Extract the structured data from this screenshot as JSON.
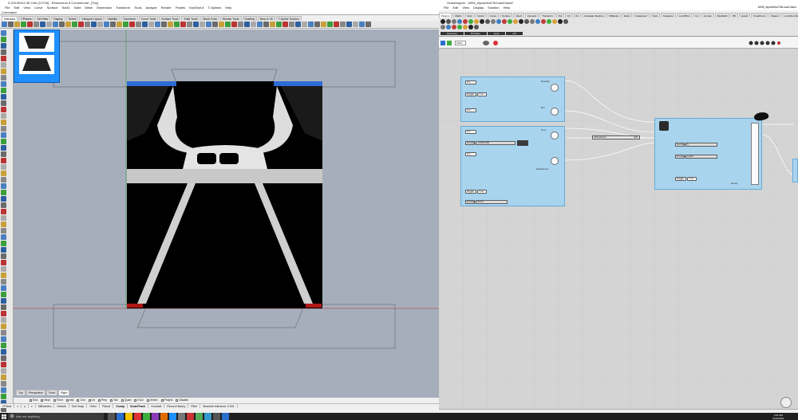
{
  "rhino": {
    "title": "S-20190312 3D Unit (12708) - Rhinoceros 6 Commercial - [Top]",
    "menu": [
      "File",
      "Edit",
      "View",
      "Curve",
      "Surface",
      "SubD",
      "Solid",
      "Mesh",
      "Dimension",
      "Transform",
      "Tools",
      "Analyze",
      "Render",
      "Panels",
      "KeyShot 8",
      "T-Splines",
      "Help"
    ],
    "command_label": "Command:",
    "command_value": "",
    "toolbar_tabs": [
      "Standard",
      "CPlanes",
      "Set View",
      "Display",
      "Select",
      "Viewport Layout",
      "Visibility",
      "Transform",
      "Curve Tools",
      "Surface Tools",
      "Solid Tools",
      "Mesh Tools",
      "Render Tools",
      "Drafting",
      "New in V6",
      "T-Spline Toolbox"
    ],
    "viewport_tabs": [
      "Top",
      "Perspective",
      "Front",
      "Right"
    ],
    "active_viewport_tab": "Right",
    "osnaps": [
      "End",
      "Near",
      "Point",
      "Mid",
      "Cen",
      "Int",
      "Perp",
      "Tan",
      "Quad",
      "Knot",
      "Vertex",
      "Project",
      "Disable"
    ],
    "status": [
      "CPlane",
      "x",
      "y",
      "z",
      "Millimeters",
      "Default",
      "Grid Snap",
      "Ortho",
      "Planar",
      "Osnap",
      "SmartTrack",
      "Gumball",
      "Record History",
      "Filter",
      "Absolute tolerance: 0.001"
    ]
  },
  "grasshopper": {
    "title": "Grasshopper - b006_bipolarNoCWLoadCases*",
    "doc_name": "b006_bipolarNoCWLoadCases",
    "menu": [
      "File",
      "Edit",
      "View",
      "Display",
      "Solution",
      "Help"
    ],
    "component_tabs": [
      "Params",
      "Maths",
      "Sets",
      "Vector",
      "Curve",
      "Surface",
      "Mesh",
      "Intersect",
      "Transform",
      "Dis",
      "Fit",
      "Kit",
      "Cartesian Meshes",
      "Millipede",
      "Extra",
      "Kangaroo2",
      "NuG",
      "Kangaroo",
      "LunchBox",
      "Ivy",
      "Human",
      "MeshEdit",
      "Bfl",
      "gHowl",
      "SmartForm",
      "Weave",
      "Lunchbox Meshes"
    ],
    "panel_groups": [
      "Geometry",
      "Primitive",
      "Input",
      "Util"
    ],
    "zoom": "100%",
    "nodes": {
      "crv1": "Crv",
      "crv2": "Crv",
      "crv3": "Crv",
      "crv4": "Crv",
      "toggle1_label": "Toggle",
      "toggle1_value": "True",
      "toggle2_label": "Toggle",
      "toggle2_value": "True",
      "toggle3_label": "Toggle",
      "toggle3_value": "True",
      "num1_label": "Number",
      "num1_value": "-10000.000",
      "num2_label": "Number",
      "num2_value": "0.570",
      "num3_label": "Number",
      "num3_value": "5",
      "num4_label": "Number",
      "num4_value": "0.400",
      "resolution_label": "nResolution",
      "resolution_value": "100",
      "port_boundary": "Boundary",
      "port_bcs": "BCs",
      "port_force": "Force",
      "port_displacement": "Displacement",
      "port_density": "Density"
    }
  },
  "taskbar": {
    "search_placeholder": "Ask me anything",
    "time": "2:51 PM",
    "date": "6/14/2019"
  },
  "colors": {
    "node_fill": "#a7d5f0",
    "viewport_bg": "#a6aebb",
    "canvas_bg": "#d4d4d4",
    "taskbar": "#1f1f1f"
  }
}
